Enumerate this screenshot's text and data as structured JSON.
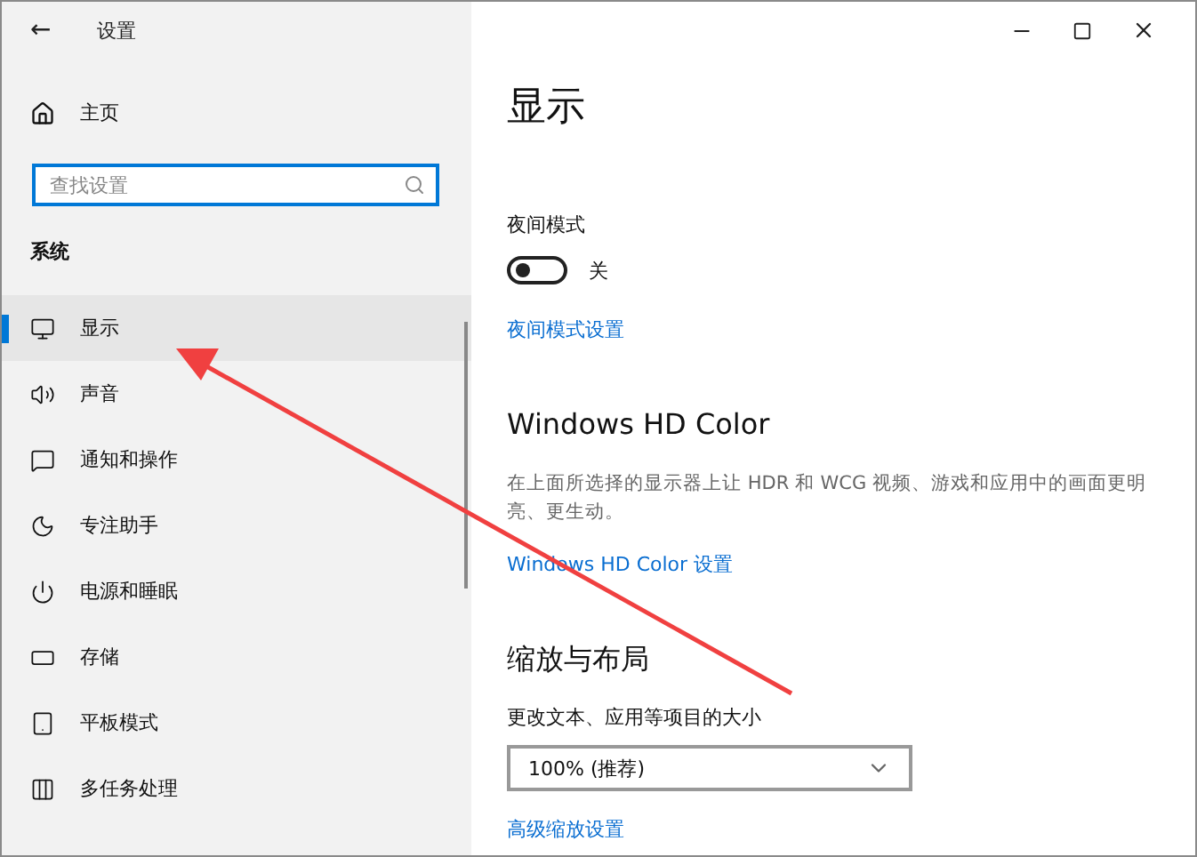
{
  "window": {
    "title": "设置",
    "back": "←"
  },
  "sidebar": {
    "home": "主页",
    "search": {
      "placeholder": "查找设置"
    },
    "section": "系统",
    "items": [
      {
        "label": "显示",
        "selected": true
      },
      {
        "label": "声音",
        "selected": false
      },
      {
        "label": "通知和操作",
        "selected": false
      },
      {
        "label": "专注助手",
        "selected": false
      },
      {
        "label": "电源和睡眠",
        "selected": false
      },
      {
        "label": "存储",
        "selected": false
      },
      {
        "label": "平板模式",
        "selected": false
      },
      {
        "label": "多任务处理",
        "selected": false
      }
    ]
  },
  "content": {
    "title": "显示",
    "night_mode": {
      "label": "夜间模式",
      "on": false,
      "state_text": "关",
      "link": "夜间模式设置"
    },
    "hd_color": {
      "heading": "Windows HD Color",
      "description": "在上面所选择的显示器上让 HDR 和 WCG 视频、游戏和应用中的画面更明亮、更生动。",
      "link": "Windows HD Color 设置"
    },
    "scale": {
      "heading": "缩放与布局",
      "label": "更改文本、应用等项目的大小",
      "value": "100% (推荐)",
      "link": "高级缩放设置"
    }
  }
}
